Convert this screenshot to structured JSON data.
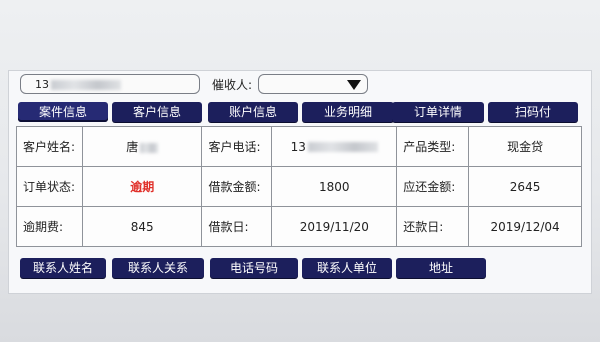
{
  "search": {
    "phone_prefix": "13",
    "collector_label": "催收人:",
    "collector_value": ""
  },
  "tabs": [
    {
      "label": "案件信息",
      "active": true
    },
    {
      "label": "客户信息"
    },
    {
      "label": "账户信息"
    },
    {
      "label": "业务明细"
    },
    {
      "label": "订单详情"
    },
    {
      "label": "扫码付"
    }
  ],
  "info": {
    "customer_name_label": "客户姓名:",
    "customer_name_value": "唐",
    "customer_phone_label": "客户电话:",
    "customer_phone_value": "13",
    "product_type_label": "产品类型:",
    "product_type_value": "现金贷",
    "order_status_label": "订单状态:",
    "order_status_value": "逾期",
    "loan_amount_label": "借款金额:",
    "loan_amount_value": "1800",
    "due_amount_label": "应还金额:",
    "due_amount_value": "2645",
    "overdue_fee_label": "逾期费:",
    "overdue_fee_value": "845",
    "loan_date_label": "借款日:",
    "loan_date_value": "2019/11/20",
    "repay_date_label": "还款日:",
    "repay_date_value": "2019/12/04"
  },
  "bottom_buttons": [
    {
      "label": "联系人姓名"
    },
    {
      "label": "联系人关系"
    },
    {
      "label": "电话号码"
    },
    {
      "label": "联系人单位"
    },
    {
      "label": "地址"
    }
  ],
  "colors": {
    "button_navy": "#1c1f5c",
    "overdue_red": "#e0302a"
  },
  "icons": {
    "collector_dropdown": "triangle-down"
  }
}
